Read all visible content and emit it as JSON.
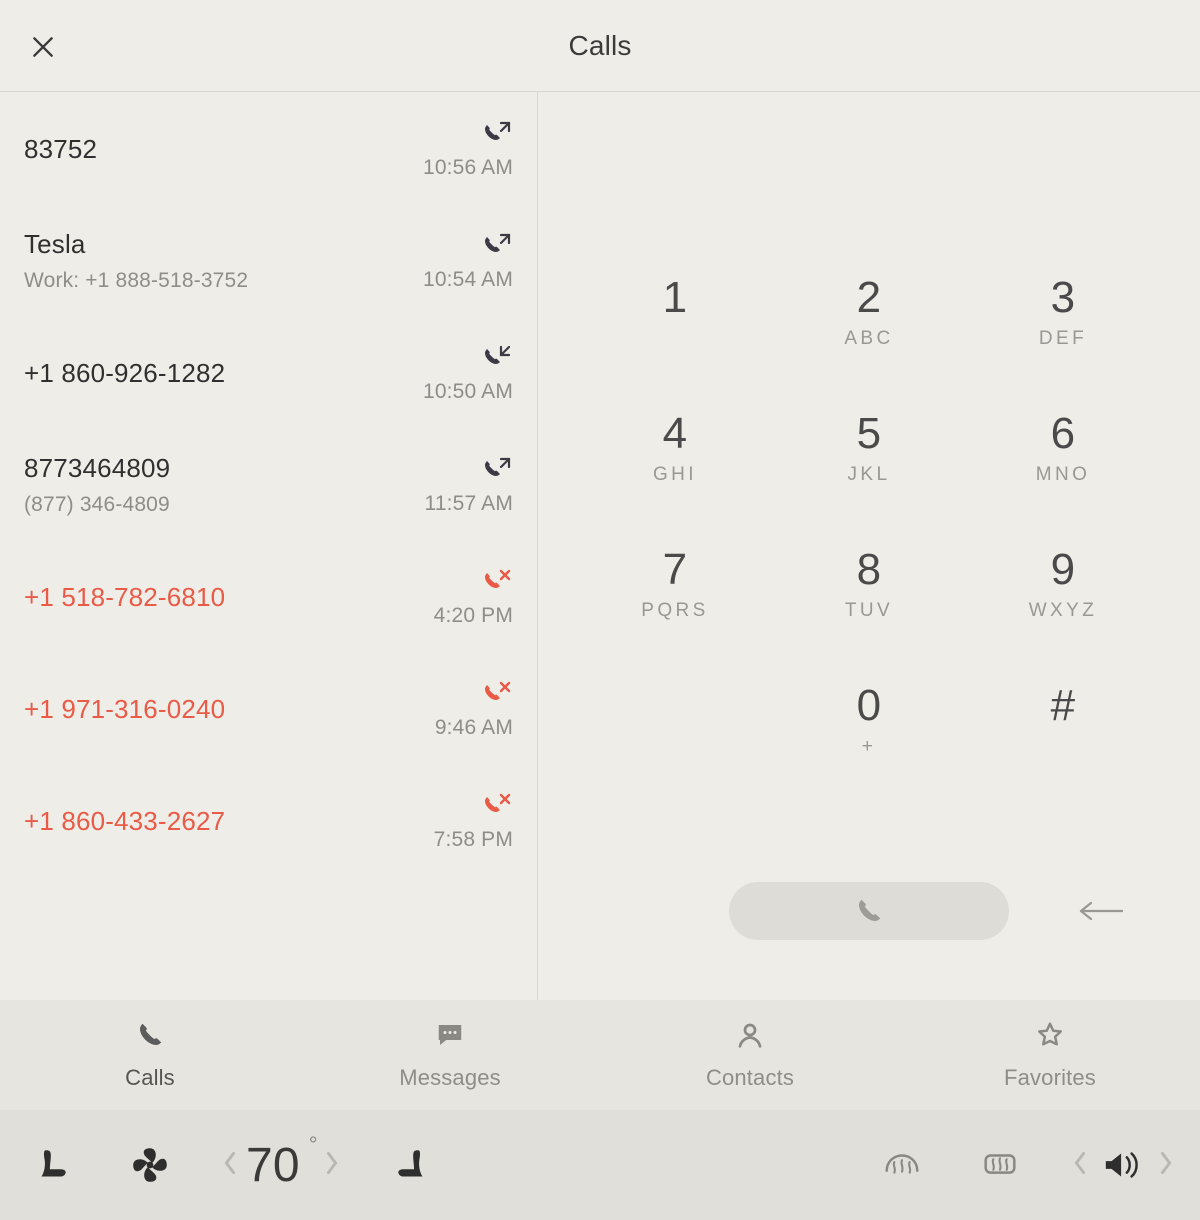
{
  "header": {
    "title": "Calls"
  },
  "calls": [
    {
      "name": "83752",
      "sub": "",
      "time": "10:56 AM",
      "type": "outgoing"
    },
    {
      "name": "Tesla",
      "sub": "Work: +1 888-518-3752",
      "time": "10:54 AM",
      "type": "outgoing"
    },
    {
      "name": "+1 860-926-1282",
      "sub": "",
      "time": "10:50 AM",
      "type": "incoming"
    },
    {
      "name": "8773464809",
      "sub": "(877) 346-4809",
      "time": "11:57 AM",
      "type": "outgoing"
    },
    {
      "name": "+1 518-782-6810",
      "sub": "",
      "time": "4:20 PM",
      "type": "missed"
    },
    {
      "name": "+1 971-316-0240",
      "sub": "",
      "time": "9:46 AM",
      "type": "missed"
    },
    {
      "name": "+1 860-433-2627",
      "sub": "",
      "time": "7:58 PM",
      "type": "missed"
    }
  ],
  "keypad": [
    {
      "digit": "1",
      "letters": ""
    },
    {
      "digit": "2",
      "letters": "ABC"
    },
    {
      "digit": "3",
      "letters": "DEF"
    },
    {
      "digit": "4",
      "letters": "GHI"
    },
    {
      "digit": "5",
      "letters": "JKL"
    },
    {
      "digit": "6",
      "letters": "MNO"
    },
    {
      "digit": "7",
      "letters": "PQRS"
    },
    {
      "digit": "8",
      "letters": "TUV"
    },
    {
      "digit": "9",
      "letters": "WXYZ"
    },
    {
      "digit": "",
      "letters": ""
    },
    {
      "digit": "0",
      "letters": "+"
    },
    {
      "digit": "#",
      "letters": ""
    }
  ],
  "tabs": [
    {
      "label": "Calls",
      "icon": "phone-icon",
      "active": true
    },
    {
      "label": "Messages",
      "icon": "message-icon",
      "active": false
    },
    {
      "label": "Contacts",
      "icon": "contacts-icon",
      "active": false
    },
    {
      "label": "Favorites",
      "icon": "star-icon",
      "active": false
    }
  ],
  "dock": {
    "temperature": "70"
  }
}
